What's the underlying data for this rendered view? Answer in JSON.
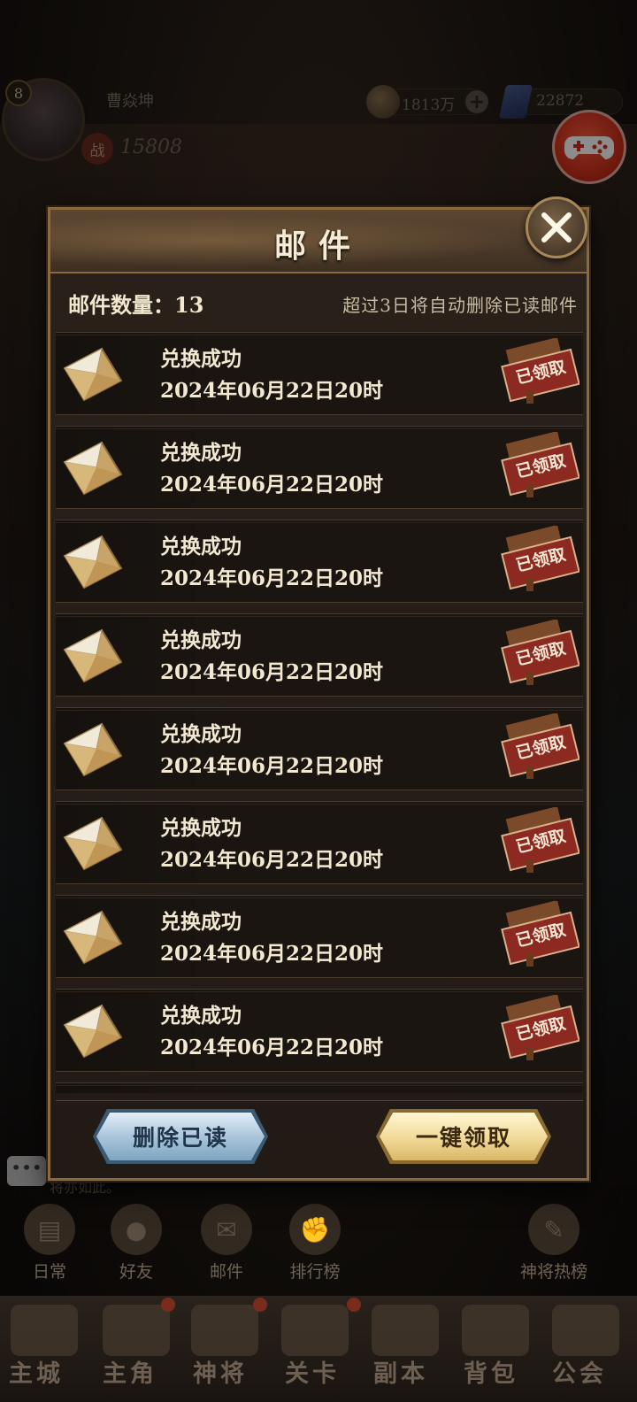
{
  "hud": {
    "level": "8",
    "player_name": "曹焱坤",
    "power_badge": "战",
    "power": "15808",
    "coins": "1813万",
    "gems": "22872"
  },
  "dialog": {
    "title": "邮件",
    "count_label": "邮件数量：13",
    "note": "超过3日将自动删除已读邮件",
    "mails": [
      {
        "title": "兑换成功",
        "date": "2024年06月22日20时",
        "status": "已领取"
      },
      {
        "title": "兑换成功",
        "date": "2024年06月22日20时",
        "status": "已领取"
      },
      {
        "title": "兑换成功",
        "date": "2024年06月22日20时",
        "status": "已领取"
      },
      {
        "title": "兑换成功",
        "date": "2024年06月22日20时",
        "status": "已领取"
      },
      {
        "title": "兑换成功",
        "date": "2024年06月22日20时",
        "status": "已领取"
      },
      {
        "title": "兑换成功",
        "date": "2024年06月22日20时",
        "status": "已领取"
      },
      {
        "title": "兑换成功",
        "date": "2024年06月22日20时",
        "status": "已领取"
      },
      {
        "title": "兑换成功",
        "date": "2024年06月22日20时",
        "status": "已领取"
      }
    ],
    "delete_read_label": "删除已读",
    "claim_all_label": "一键领取"
  },
  "chat": {
    "preview": "将亦如此。"
  },
  "quick_menu": [
    {
      "label": "日常",
      "icon": "map-icon"
    },
    {
      "label": "好友",
      "icon": "friends-icon"
    },
    {
      "label": "邮件",
      "icon": "mail-icon"
    },
    {
      "label": "排行榜",
      "icon": "fist-icon"
    },
    {
      "label": "神将热榜",
      "icon": "scroll-icon"
    }
  ],
  "tabs": [
    {
      "label": "主城"
    },
    {
      "label": "主角"
    },
    {
      "label": "神将"
    },
    {
      "label": "关卡"
    },
    {
      "label": "副本"
    },
    {
      "label": "背包"
    },
    {
      "label": "公会"
    }
  ],
  "colors": {
    "panel_border": "#8a6a3e",
    "stamp_red": "#8c2a22",
    "claim_gold": "#f3dc9c",
    "delete_blue": "#aac6dc"
  }
}
